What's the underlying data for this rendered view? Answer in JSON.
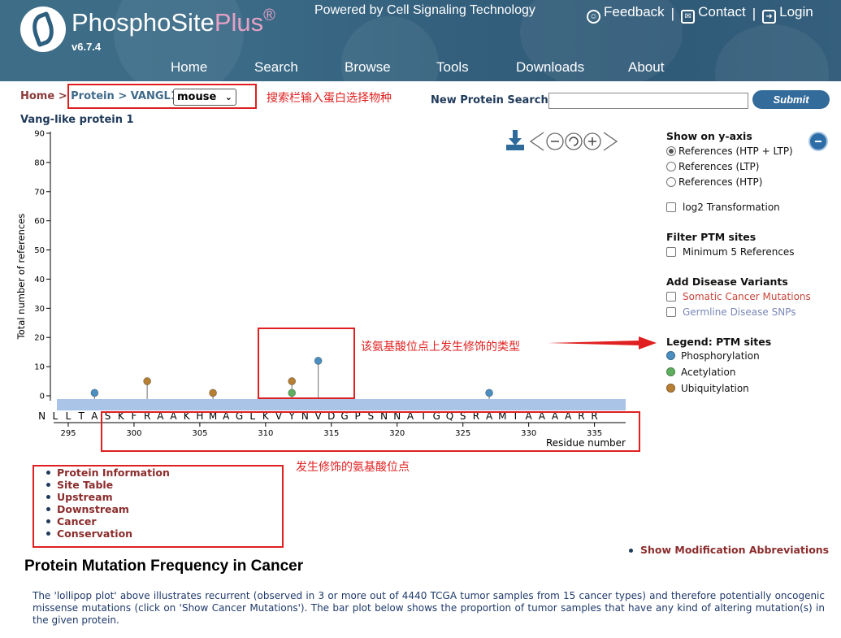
{
  "header": {
    "logo_name": "PhosphoSite",
    "logo_plus": "Plus",
    "logo_reg": "®",
    "version": "v6.7.4",
    "powered_by": "Powered by Cell Signaling Technology",
    "top_links": [
      {
        "label": "Feedback",
        "icon": "smiley-icon"
      },
      {
        "label": "Contact",
        "icon": "envelope-icon"
      },
      {
        "label": "Login",
        "icon": "login-icon"
      }
    ],
    "separator": "|",
    "nav": [
      "Home",
      "Search",
      "Browse",
      "Tools",
      "Downloads",
      "About"
    ]
  },
  "breadcrumb": {
    "home": "Home",
    "sep": ">",
    "protein": "Protein",
    "current": "VANGL1",
    "species_selected": "mouse"
  },
  "annotations": {
    "species_note": "搜索栏输入蛋白选择物种",
    "ptm_type_note": "该氨基酸位点上发生修饰的类型",
    "site_note": "发生修饰的氨基酸位点"
  },
  "search": {
    "label": "New Protein Search:",
    "value": "",
    "submit_label": "Submit"
  },
  "protein_title": "Vang-like protein 1",
  "right_panel": {
    "yaxis_title": "Show on y-axis",
    "yaxis_options": [
      {
        "label": "References (HTP + LTP)",
        "checked": true
      },
      {
        "label": "References (LTP)",
        "checked": false
      },
      {
        "label": "References (HTP)",
        "checked": false
      }
    ],
    "log2_label": "log2 Transformation",
    "filter_title": "Filter PTM sites",
    "filter_label": "Minimum 5 References",
    "disease_title": "Add Disease Variants",
    "somatic_label": "Somatic Cancer Mutations",
    "germline_label": "Germline Disease SNPs",
    "legend_title": "Legend: PTM sites",
    "legend": [
      {
        "label": "Phosphorylation",
        "color": "#4a8fbf"
      },
      {
        "label": "Acetylation",
        "color": "#5fae5f"
      },
      {
        "label": "Ubiquitylation",
        "color": "#b77f33"
      }
    ]
  },
  "chart_data": {
    "type": "lollipop",
    "ylabel": "Total number of references",
    "xlabel": "Residue number",
    "ylim": [
      0,
      90
    ],
    "yticks": [
      0,
      10,
      20,
      30,
      40,
      50,
      60,
      70,
      80,
      90
    ],
    "xticks": [
      295,
      300,
      305,
      310,
      315,
      320,
      325,
      330,
      335
    ],
    "start_residue": 293,
    "sequence": [
      "N",
      "L",
      "L",
      "T",
      "A",
      "S",
      "K",
      "F",
      "R",
      "A",
      "A",
      "K",
      "H",
      "M",
      "A",
      "G",
      "L",
      "K",
      "V",
      "Y",
      "N",
      "V",
      "D",
      "G",
      "P",
      "S",
      "N",
      "N",
      "A",
      "T",
      "G",
      "Q",
      "S",
      "R",
      "A",
      "M",
      "I",
      "A",
      "A",
      "A",
      "A",
      "R",
      "R"
    ],
    "sites": [
      {
        "residue": 297,
        "value": 1,
        "type": "Phosphorylation"
      },
      {
        "residue": 301,
        "value": 5,
        "type": "Ubiquitylation"
      },
      {
        "residue": 306,
        "value": 1,
        "type": "Ubiquitylation"
      },
      {
        "residue": 312,
        "value": 5,
        "type": "Ubiquitylation"
      },
      {
        "residue": 312,
        "value": 1,
        "type": "Acetylation"
      },
      {
        "residue": 314,
        "value": 12,
        "type": "Phosphorylation"
      },
      {
        "residue": 327,
        "value": 1,
        "type": "Phosphorylation"
      }
    ]
  },
  "links": [
    "Protein Information",
    "Site Table",
    "Upstream",
    "Downstream",
    "Cancer",
    "Conservation"
  ],
  "abbr_link": "Show Modification Abbreviations",
  "mutation": {
    "title": "Protein Mutation Frequency in Cancer",
    "description": "The 'lollipop plot' above illustrates recurrent (observed in 3 or more out of 4440 TCGA tumor samples from 15 cancer types) and therefore potentially oncogenic missense mutations (click on 'Show Cancer Mutations'). The bar plot below shows the proportion of tumor samples that have any kind of altering mutation(s) in the given protein."
  }
}
